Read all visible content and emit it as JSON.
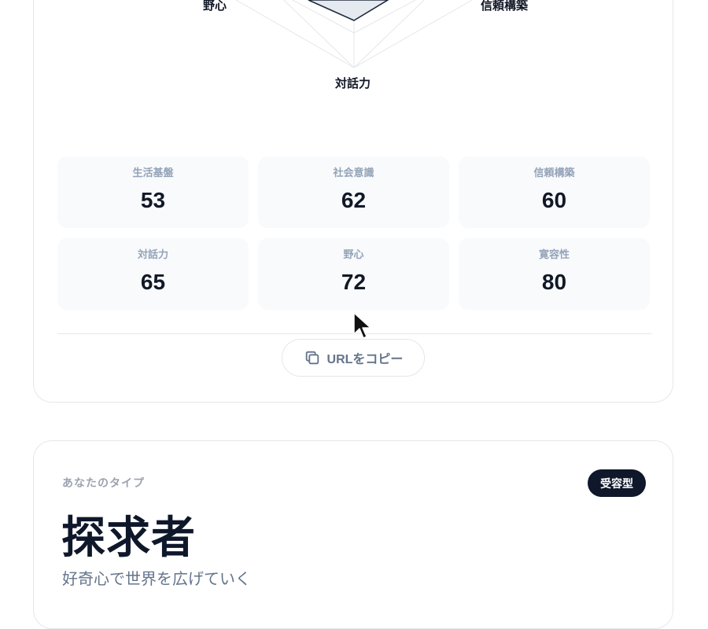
{
  "radar": {
    "labels": {
      "left": "野心",
      "right": "信頼構築",
      "bottom": "対話力"
    }
  },
  "stats": [
    {
      "label": "生活基盤",
      "value": "53"
    },
    {
      "label": "社会意識",
      "value": "62"
    },
    {
      "label": "信頼構築",
      "value": "60"
    },
    {
      "label": "対話力",
      "value": "65"
    },
    {
      "label": "野心",
      "value": "72"
    },
    {
      "label": "寛容性",
      "value": "80"
    }
  ],
  "share": {
    "copy_label": "URLをコピー",
    "icon": "copy-icon"
  },
  "type_result": {
    "caption": "あなたのタイプ",
    "badge": "受容型",
    "name": "探求者",
    "description": "好奇心で世界を広げていく"
  },
  "colors": {
    "ink": "#0f172a",
    "muted": "#94a3b8",
    "stat_bg": "#f8fafc",
    "border": "#e5e7eb"
  }
}
